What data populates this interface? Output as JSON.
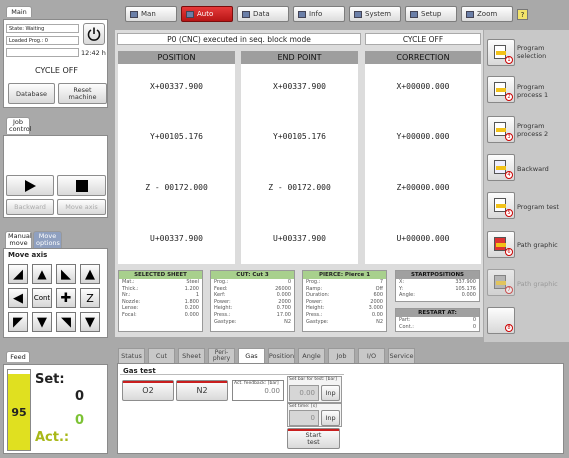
{
  "main_tab": "Main",
  "state": "State: Waiting",
  "loaded_prog": "Loaded Prog.: 0",
  "time": "12:42 h",
  "cycle_status": "CYCLE OFF",
  "database_btn": "Database",
  "reset_btn": "Reset machine",
  "job_control_tab": "Job control",
  "backward_btn": "Backward",
  "move_axis_btn": "Move axis",
  "manual_move_tab": "Manual move",
  "move_options_tab": "Move options",
  "move_axis_title": "Move axis",
  "cont_label": "Cont",
  "z_label": "Z",
  "toolbar": [
    "Man",
    "Auto",
    "Data",
    "Info",
    "System",
    "Setup",
    "Zoom"
  ],
  "toolbar_help": "?",
  "status_msg": "P0 (CNC) executed in seq. block mode",
  "cycle_header": "CYCLE OFF",
  "columns": [
    {
      "title": "POSITION",
      "values": [
        "X+00337.900",
        "Y+00105.176",
        "Z - 00172.000",
        "U+00337.900"
      ]
    },
    {
      "title": "END POINT",
      "values": [
        "X+00337.900",
        "Y+00105.176",
        "Z - 00172.000",
        "U+00337.900"
      ]
    },
    {
      "title": "CORRECTION",
      "values": [
        "X+00000.000",
        "Y+00000.000",
        "Z+00000.000",
        "U+00000.000"
      ]
    }
  ],
  "selected_sheet": {
    "title": "SELECTED SHEET",
    "rows": [
      [
        "Mat.:",
        "Steel"
      ],
      [
        "Thick.:",
        "1.200"
      ],
      [
        "Nr.:",
        "1"
      ],
      [
        "Nozzle:",
        "1.800"
      ],
      [
        "Lense:",
        "0.200"
      ],
      [
        "Focal:",
        "0.000"
      ]
    ]
  },
  "cut": {
    "title": "CUT: Cut 3",
    "rows": [
      [
        "Prog.:",
        "0"
      ],
      [
        "Feed:",
        "26000"
      ],
      [
        "Kerf:",
        "0.000"
      ],
      [
        "Power:",
        "2000"
      ],
      [
        "Height:",
        "0.700"
      ],
      [
        "Press.:",
        "17.00"
      ],
      [
        "Gastype:",
        "N2"
      ]
    ]
  },
  "pierce": {
    "title": "PIERCE: Pierce 1",
    "rows": [
      [
        "Prog.:",
        "7"
      ],
      [
        "Ramp:",
        "Off"
      ],
      [
        "Duration:",
        "600"
      ],
      [
        "Power:",
        "2000"
      ],
      [
        "Height:",
        "3.000"
      ],
      [
        "Press.:",
        "0.00"
      ],
      [
        "Gastype:",
        "N2"
      ]
    ]
  },
  "startpos": {
    "title": "STARTPOSITIONS",
    "rows": [
      [
        "X:",
        "337.900"
      ],
      [
        "Y:",
        "105.176"
      ],
      [
        "Angle:",
        "0.000"
      ]
    ]
  },
  "restart": {
    "title": "RESTART AT:",
    "rows": [
      [
        "Part:",
        "0"
      ],
      [
        "Cont.:",
        "0"
      ]
    ]
  },
  "sidebar": [
    {
      "label": "Program selection",
      "num": "1"
    },
    {
      "label": "Program process 1",
      "num": "2"
    },
    {
      "label": "Program process 2",
      "num": "3"
    },
    {
      "label": "Backward",
      "num": "4"
    },
    {
      "label": "Program test",
      "num": "5"
    },
    {
      "label": "Path graphic",
      "num": "6"
    },
    {
      "label": "Path graphic",
      "num": "7"
    },
    {
      "label": "",
      "num": "8"
    }
  ],
  "feed_tab": "Feed",
  "feed_percent": "95",
  "feed_set_label": "Set:",
  "feed_set_value": "0",
  "feed_act_value": "0",
  "feed_act_label": "Act.:",
  "bottom_tabs": [
    "Status",
    "Cut",
    "Sheet",
    "Peri-phery",
    "Gas",
    "Position",
    "Angle",
    "Job",
    "I/O",
    "Service"
  ],
  "gas_test_title": "Gas test",
  "o2_btn": "O2",
  "n2_btn": "N2",
  "act_feedback_label": "Act. feedback: [bar]",
  "act_feedback_value": "0.00",
  "set_bar_label": "Set bar for test: [bar]",
  "set_bar_value": "0.00",
  "inp_label": "Inp",
  "set_time_label": "Set time: [s]",
  "set_time_value": "0",
  "start_test_btn": "Start test",
  "colors": {
    "accent_red": "#c91e1e",
    "green_header": "#a8d08d",
    "feed_yellow": "#e0e020"
  }
}
